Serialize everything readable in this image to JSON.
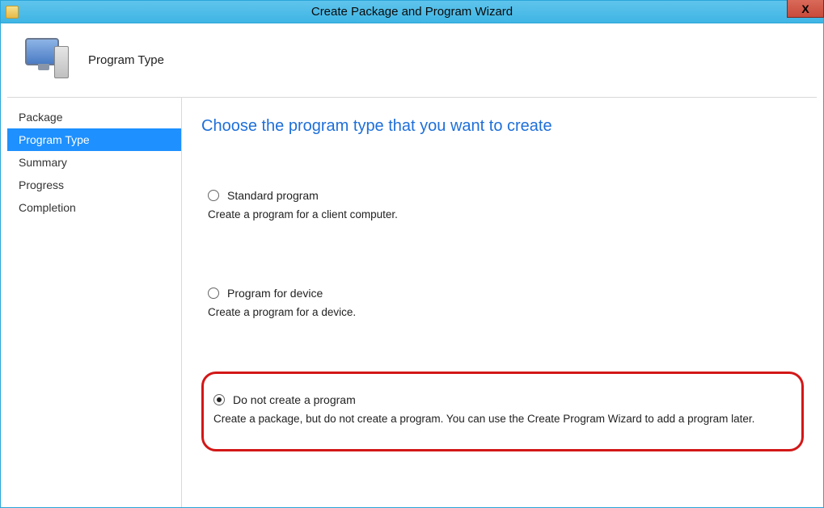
{
  "window": {
    "title": "Create Package and Program Wizard",
    "close_glyph": "X"
  },
  "header": {
    "title": "Program Type"
  },
  "sidebar": {
    "items": [
      {
        "label": "Package",
        "selected": false
      },
      {
        "label": "Program Type",
        "selected": true
      },
      {
        "label": "Summary",
        "selected": false
      },
      {
        "label": "Progress",
        "selected": false
      },
      {
        "label": "Completion",
        "selected": false
      }
    ]
  },
  "main": {
    "heading": "Choose the program type that you want to create",
    "options": [
      {
        "label": "Standard program",
        "description": "Create a program for a client computer.",
        "checked": false
      },
      {
        "label": "Program for device",
        "description": "Create a program for a device.",
        "checked": false
      },
      {
        "label": "Do not create a program",
        "description": "Create a package, but do not create a program. You can use the Create Program Wizard to add a program later.",
        "checked": true
      }
    ]
  }
}
